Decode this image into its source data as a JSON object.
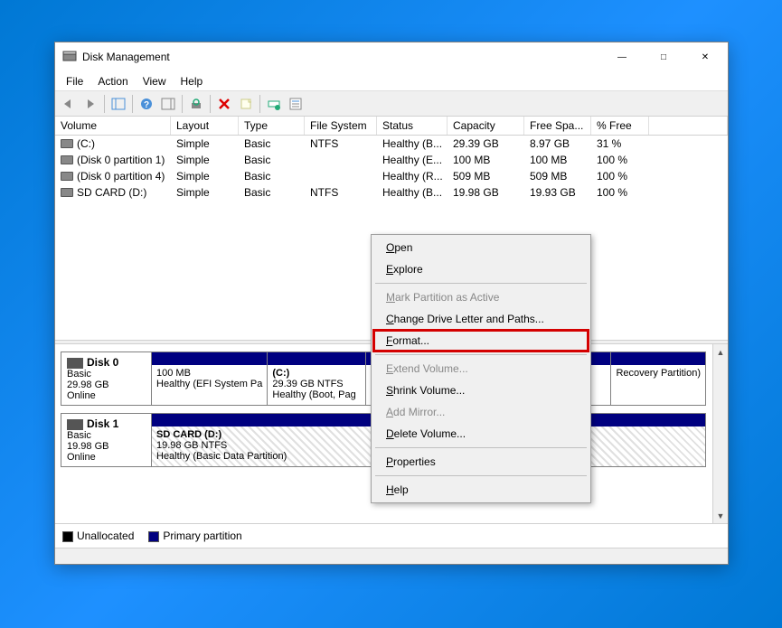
{
  "window": {
    "title": "Disk Management"
  },
  "menu": {
    "file": "File",
    "action": "Action",
    "view": "View",
    "help": "Help"
  },
  "columns": {
    "volume": "Volume",
    "layout": "Layout",
    "type": "Type",
    "filesystem": "File System",
    "status": "Status",
    "capacity": "Capacity",
    "freespace": "Free Spa...",
    "pctfree": "% Free"
  },
  "volumes": [
    {
      "name": "(C:)",
      "layout": "Simple",
      "type": "Basic",
      "fs": "NTFS",
      "status": "Healthy (B...",
      "capacity": "29.39 GB",
      "free": "8.97 GB",
      "pct": "31 %"
    },
    {
      "name": "(Disk 0 partition 1)",
      "layout": "Simple",
      "type": "Basic",
      "fs": "",
      "status": "Healthy (E...",
      "capacity": "100 MB",
      "free": "100 MB",
      "pct": "100 %"
    },
    {
      "name": "(Disk 0 partition 4)",
      "layout": "Simple",
      "type": "Basic",
      "fs": "",
      "status": "Healthy (R...",
      "capacity": "509 MB",
      "free": "509 MB",
      "pct": "100 %"
    },
    {
      "name": "SD CARD (D:)",
      "layout": "Simple",
      "type": "Basic",
      "fs": "NTFS",
      "status": "Healthy (B...",
      "capacity": "19.98 GB",
      "free": "19.93 GB",
      "pct": "100 %"
    }
  ],
  "disks": [
    {
      "title": "Disk 0",
      "type": "Basic",
      "size": "29.98 GB",
      "status": "Online",
      "parts": [
        {
          "title": "",
          "line1": "100 MB",
          "line2": "Healthy (EFI System Pa",
          "flex": 0.22,
          "hatched": false
        },
        {
          "title": "(C:)",
          "line1": "29.39 GB NTFS",
          "line2": "Healthy (Boot, Pag",
          "flex": 0.2,
          "hatched": false
        },
        {
          "title": "",
          "line1": "",
          "line2": "Recovery Partition)",
          "flex": 0.18,
          "hatched": false
        }
      ]
    },
    {
      "title": "Disk 1",
      "type": "Basic",
      "size": "19.98 GB",
      "status": "Online",
      "parts": [
        {
          "title": "SD CARD  (D:)",
          "line1": "19.98 GB NTFS",
          "line2": "Healthy (Basic Data Partition)",
          "flex": 1,
          "hatched": true
        }
      ]
    }
  ],
  "legend": {
    "unallocated": "Unallocated",
    "primary": "Primary partition"
  },
  "context": {
    "open": "Open",
    "explore": "Explore",
    "mark_active": "Mark Partition as Active",
    "change_letter": "Change Drive Letter and Paths...",
    "format": "Format...",
    "extend": "Extend Volume...",
    "shrink": "Shrink Volume...",
    "add_mirror": "Add Mirror...",
    "delete": "Delete Volume...",
    "properties": "Properties",
    "help": "Help"
  }
}
